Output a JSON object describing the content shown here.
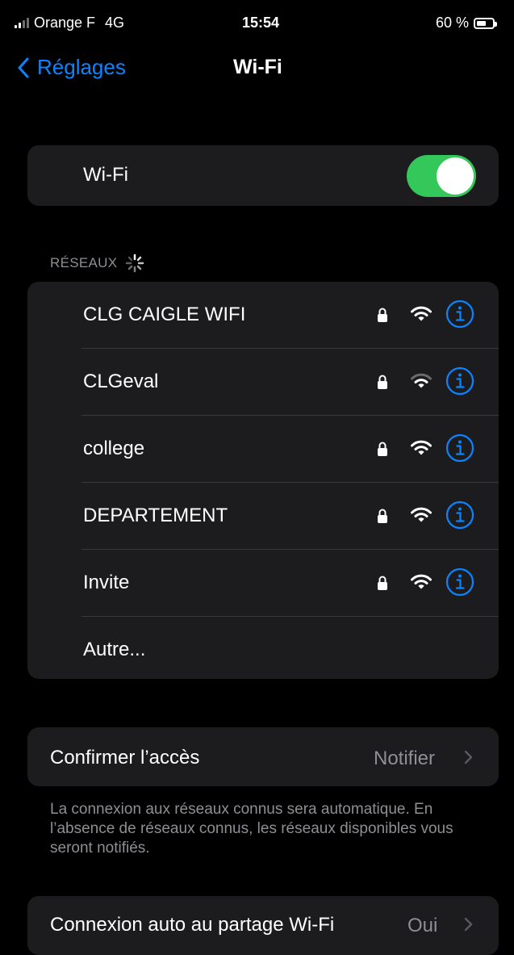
{
  "status_bar": {
    "carrier": "Orange F",
    "network": "4G",
    "time": "15:54",
    "battery": "60 %"
  },
  "nav": {
    "back_label": "Réglages",
    "title": "Wi-Fi"
  },
  "wifi_toggle": {
    "label": "Wi-Fi",
    "on": true
  },
  "networks_section": {
    "header": "RÉSEAUX"
  },
  "networks": [
    {
      "name": "CLG CAIGLE WIFI",
      "locked": true
    },
    {
      "name": "CLGeval",
      "locked": true
    },
    {
      "name": "college",
      "locked": true
    },
    {
      "name": "DEPARTEMENT",
      "locked": true
    },
    {
      "name": "Invite",
      "locked": true
    }
  ],
  "other_network": {
    "label": "Autre..."
  },
  "ask_to_join": {
    "label": "Confirmer l’accès",
    "value": "Notifier",
    "footer": "La connexion aux réseaux connus sera automatique. En l’absence de réseaux connus, les réseaux disponibles vous seront notifiés."
  },
  "auto_hotspot": {
    "label": "Connexion auto au partage Wi-Fi",
    "value": "Oui"
  },
  "colors": {
    "accent": "#0a84ff",
    "switch_on": "#34c759",
    "group_bg": "#1c1c1e",
    "secondary_text": "#8e8e93"
  }
}
